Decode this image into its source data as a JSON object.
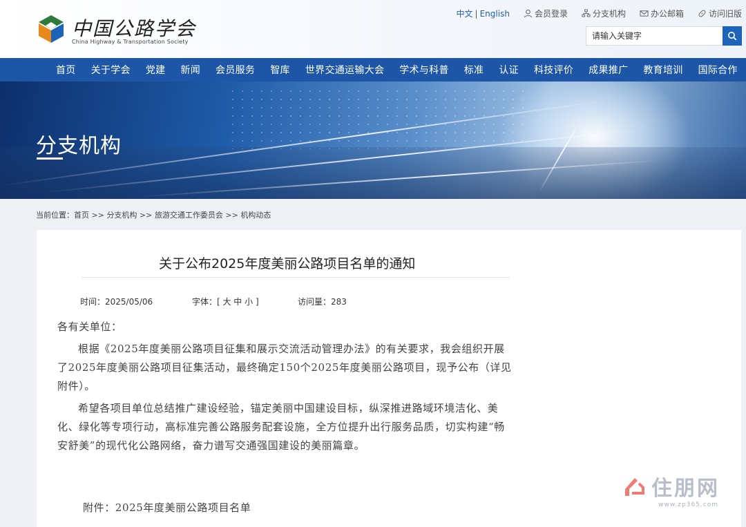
{
  "header": {
    "logo_cn": "中国公路学会",
    "logo_en": "China Highway & Transportation Society",
    "lang_cn": "中文",
    "lang_sep": "|",
    "lang_en": "English",
    "links": [
      {
        "label": "会员登录",
        "icon": "user-icon"
      },
      {
        "label": "分支机构",
        "icon": "org-icon"
      },
      {
        "label": "办公邮箱",
        "icon": "mail-icon"
      },
      {
        "label": "访问旧版",
        "icon": "link-icon"
      }
    ],
    "search_placeholder": "请输入关键字"
  },
  "nav": {
    "items": [
      "首页",
      "关于学会",
      "党建",
      "新闻",
      "会员服务",
      "智库",
      "世界交通运输大会",
      "学术与科普",
      "标准",
      "认证",
      "科技评价",
      "成果推广",
      "教育培训",
      "国际合作"
    ]
  },
  "banner": {
    "title": "分支机构"
  },
  "breadcrumb": {
    "prefix": "当前位置：",
    "items": [
      "首页",
      "分支机构",
      "旅游交通工作委员会",
      "机构动态"
    ],
    "sep": " >> "
  },
  "article": {
    "title": "关于公布2025年度美丽公路项目名单的通知",
    "time_label": "时间：2025/05/06",
    "font_label": "字体：[ 大 中 小 ]",
    "views_label": "访问量：283",
    "salutation": "各有关单位：",
    "para1": "根据《2025年度美丽公路项目征集和展示交流活动管理办法》的有关要求，我会组织开展了2025年度美丽公路项目征集活动，最终确定150个2025年度美丽公路项目，现予公布（详见附件）。",
    "para2": "希望各项目单位总结推广建设经验，锚定美丽中国建设目标，纵深推进路域环境洁化、美化、绿化等专项行动，高标准完善公路服务配套设施，全方位提升出行服务品质，切实构建“畅安舒美”的现代化公路网络，奋力谱写交通强国建设的美丽篇章。",
    "attachment": "附件：2025年度美丽公路项目名单"
  },
  "watermark": {
    "text": "住朋网",
    "sub": "www.zp365.com"
  },
  "colors": {
    "nav_bg": "#1e56a7",
    "accent": "#1d63b8"
  }
}
